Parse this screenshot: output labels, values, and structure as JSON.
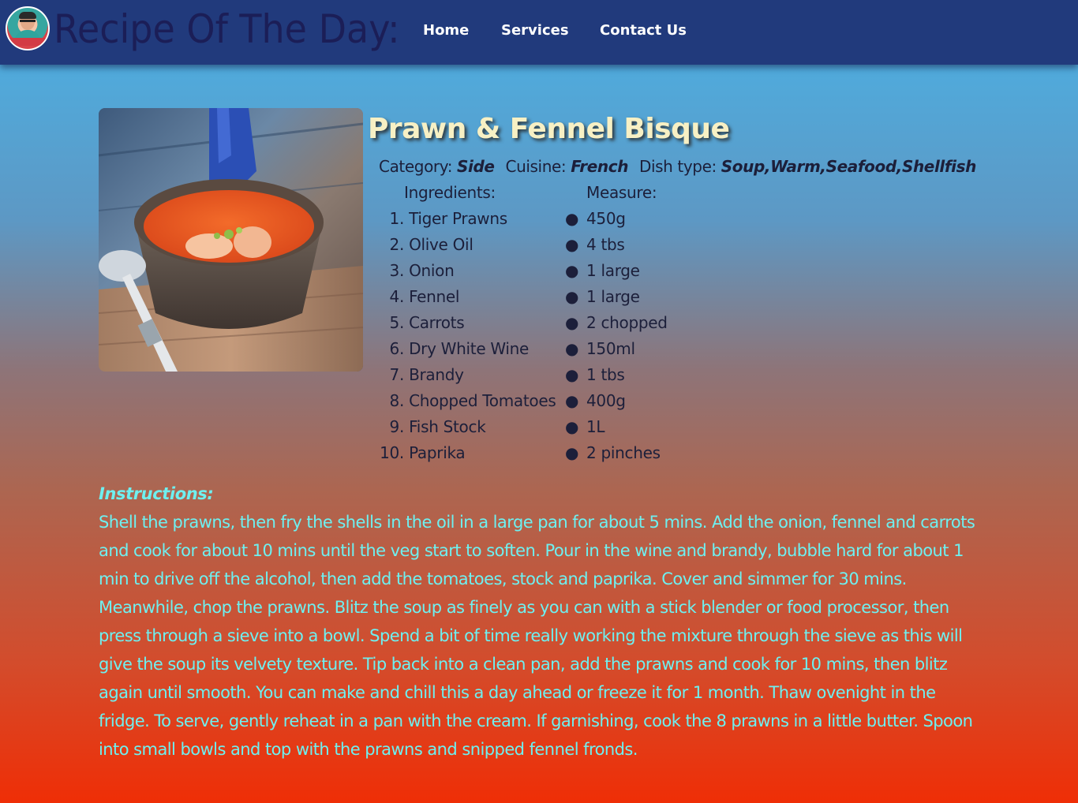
{
  "header": {
    "site_title": "Recipe Of The Day:",
    "nav": {
      "home": "Home",
      "services": "Services",
      "contact": "Contact Us"
    }
  },
  "recipe": {
    "title": "Prawn & Fennel Bisque",
    "category_label": "Category:",
    "category": "Side",
    "cuisine_label": "Cuisine:",
    "cuisine": "French",
    "dish_type_label": "Dish type:",
    "dish_type": "Soup,Warm,Seafood,Shellfish",
    "ingredients_heading": "Ingredients:",
    "measure_heading": "Measure:",
    "ingredients": [
      {
        "num": "1.",
        "name": "Tiger Prawns"
      },
      {
        "num": "2.",
        "name": "Olive Oil"
      },
      {
        "num": "3.",
        "name": "Onion"
      },
      {
        "num": "4.",
        "name": "Fennel"
      },
      {
        "num": "5.",
        "name": "Carrots"
      },
      {
        "num": "6.",
        "name": "Dry White Wine"
      },
      {
        "num": "7.",
        "name": "Brandy"
      },
      {
        "num": "8.",
        "name": "Chopped Tomatoes"
      },
      {
        "num": "9.",
        "name": "Fish Stock"
      },
      {
        "num": "10.",
        "name": "Paprika"
      }
    ],
    "measures": [
      "450g",
      "4 tbs",
      "1 large",
      "1 large",
      "2 chopped",
      "150ml",
      "1 tbs",
      "400g",
      "1L",
      "2 pinches"
    ],
    "instructions_heading": "Instructions:",
    "instructions": "Shell the prawns, then fry the shells in the oil in a large pan for about 5 mins. Add the onion, fennel and carrots and cook for about 10 mins until the veg start to soften. Pour in the wine and brandy, bubble hard for about 1 min to drive off the alcohol, then add the tomatoes, stock and paprika. Cover and simmer for 30 mins. Meanwhile, chop the prawns. Blitz the soup as finely as you can with a stick blender or food processor, then press through a sieve into a bowl. Spend a bit of time really working the mixture through the sieve as this will give the soup its velvety texture. Tip back into a clean pan, add the prawns and cook for 10 mins, then blitz again until smooth. You can make and chill this a day ahead or freeze it for 1 month. Thaw ovenight in the fridge. To serve, gently reheat in a pan with the cream. If garnishing, cook the 8 prawns in a little butter. Spoon into small bowls and top with the prawns and snipped fennel fronds."
  }
}
